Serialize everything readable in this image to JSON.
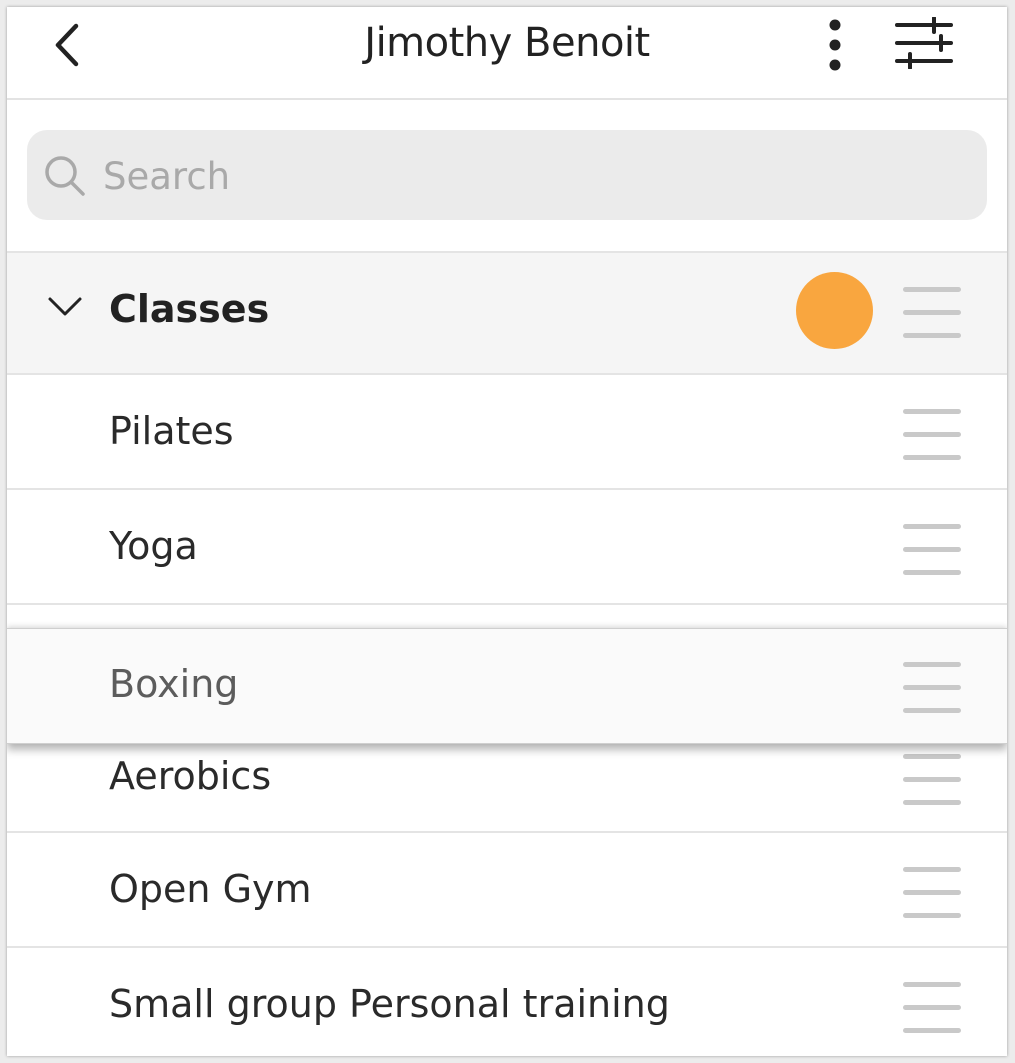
{
  "header": {
    "title": "Jimothy Benoit",
    "back_icon": "chevron-left-icon",
    "more_icon": "more-vertical-icon",
    "filter_icon": "sliders-icon"
  },
  "search": {
    "placeholder": "Search",
    "value": ""
  },
  "section": {
    "label": "Classes",
    "expanded": true,
    "badge_color": "#f9a63f"
  },
  "items": [
    {
      "label": "Pilates"
    },
    {
      "label": "Yoga"
    },
    {
      "label": "Boxing",
      "state": "dragging"
    },
    {
      "label": "Aerobics"
    },
    {
      "label": "Open Gym"
    },
    {
      "label": "Small group Personal training"
    }
  ]
}
